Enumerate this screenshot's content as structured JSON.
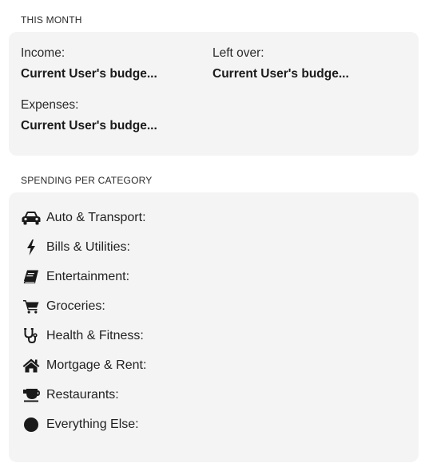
{
  "this_month": {
    "heading": "THIS MONTH",
    "income": {
      "label": "Income:",
      "value": "Current User's budge..."
    },
    "left_over": {
      "label": "Left over:",
      "value": "Current User's budge..."
    },
    "expenses": {
      "label": "Expenses:",
      "value": "Current User's budge..."
    }
  },
  "spending": {
    "heading": "SPENDING PER CATEGORY",
    "categories": [
      {
        "label": "Auto & Transport:",
        "icon": "car-icon"
      },
      {
        "label": "Bills & Utilities:",
        "icon": "bolt-icon"
      },
      {
        "label": "Entertainment:",
        "icon": "book-icon"
      },
      {
        "label": "Groceries:",
        "icon": "cart-icon"
      },
      {
        "label": "Health & Fitness:",
        "icon": "stethoscope-icon"
      },
      {
        "label": "Mortgage & Rent:",
        "icon": "home-icon"
      },
      {
        "label": "Restaurants:",
        "icon": "coffee-icon"
      },
      {
        "label": "Everything Else:",
        "icon": "circle-icon"
      }
    ]
  },
  "colors": {
    "card_background": "#f4f4f4",
    "icon": "#1a1a1a"
  }
}
